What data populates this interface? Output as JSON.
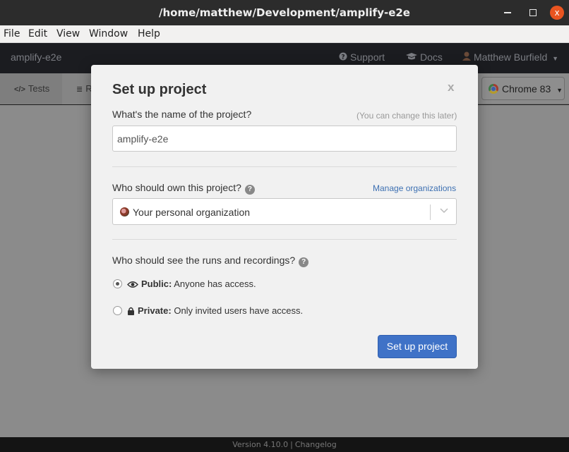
{
  "window": {
    "title": "/home/matthew/Development/amplify-e2e",
    "close_glyph": "x"
  },
  "menu": [
    "File",
    "Edit",
    "View",
    "Window",
    "Help"
  ],
  "header": {
    "project": "amplify-e2e",
    "support": "Support",
    "docs": "Docs",
    "user": "Matthew Burfield",
    "support_icon": "question-circle-icon",
    "docs_icon": "graduation-cap-icon",
    "user_icon": "user-avatar-icon"
  },
  "tabs": {
    "tests": "Tests",
    "runs": "R"
  },
  "browser": {
    "label": "Chrome 83",
    "icon": "chrome-icon"
  },
  "modal": {
    "title": "Set up project",
    "close": "x",
    "name_label": "What's the name of the project?",
    "name_hint": "(You can change this later)",
    "name_value": "amplify-e2e",
    "owner_label": "Who should own this project?",
    "manage_link": "Manage organizations",
    "owner_value": "Your personal organization",
    "visibility_label": "Who should see the runs and recordings?",
    "public_title": "Public:",
    "public_desc": "Anyone has access.",
    "private_title": "Private:",
    "private_desc": "Only invited users have access.",
    "submit": "Set up project",
    "help_glyph": "?"
  },
  "footer": {
    "version": "Version 4.10.0",
    "separator": "|",
    "changelog": "Changelog"
  },
  "colors": {
    "primary": "#3f72c7",
    "link": "#3d70b2",
    "close_button": "#e95420"
  }
}
